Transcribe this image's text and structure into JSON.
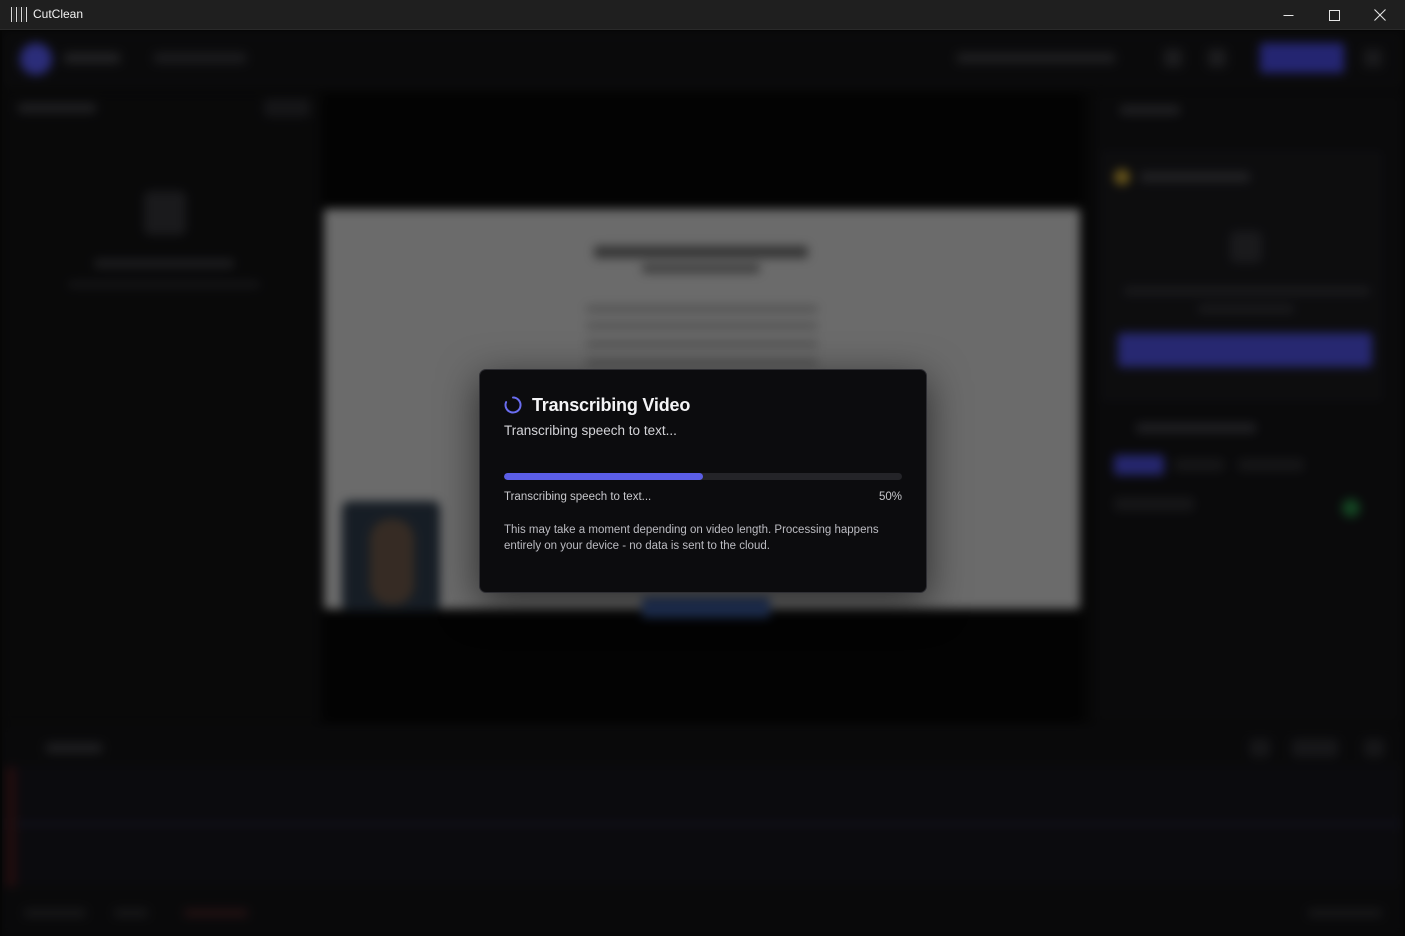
{
  "window": {
    "title": "CutClean",
    "minimize_icon": "minimize-icon",
    "maximize_icon": "maximize-icon",
    "close_icon": "close-icon"
  },
  "modal": {
    "icon": "spinner-icon",
    "title": "Transcribing Video",
    "subtitle": "Transcribing speech to text...",
    "progress": {
      "value_percent": 50,
      "label": "Transcribing speech to text...",
      "percent_text": "50%"
    },
    "note": "This may take a moment depending on video length. Processing happens entirely on your device - no data is sent to the cloud."
  },
  "colors": {
    "accent": "#5b5ee6",
    "modal_bg": "#0c0c0e",
    "titlebar_bg": "#1f1f1f"
  }
}
